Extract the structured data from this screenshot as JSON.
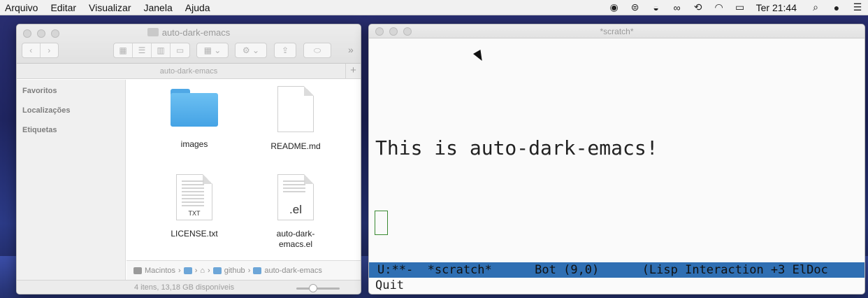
{
  "menubar": {
    "items": [
      "Arquivo",
      "Editar",
      "Visualizar",
      "Janela",
      "Ajuda"
    ],
    "status_icons": [
      "record-icon",
      "network-icon",
      "mask-icon",
      "glasses-icon",
      "time-machine-icon",
      "wifi-icon",
      "battery-icon"
    ],
    "clock": "Ter 21:44"
  },
  "finder": {
    "title": "auto-dark-emacs",
    "path_title": "auto-dark-emacs",
    "sidebar": [
      "Favoritos",
      "Localizações",
      "Etiquetas"
    ],
    "files": [
      {
        "name": "images",
        "kind": "folder"
      },
      {
        "name": "README.md",
        "kind": "doc"
      },
      {
        "name": "LICENSE.txt",
        "kind": "txt",
        "badge": "TXT"
      },
      {
        "name": "auto-dark-\nemacs.el",
        "kind": "el",
        "badge": ".el"
      }
    ],
    "breadcrumb": [
      "Macintos",
      "",
      "",
      "github",
      "auto-dark-emacs"
    ],
    "status": "4 itens, 13,18 GB disponíveis"
  },
  "emacs": {
    "title": "*scratch*",
    "body_text": "This is auto-dark-emacs!",
    "modeline": "U:**-  *scratch*      Bot (9,0)      (Lisp Interaction +3 ElDoc",
    "minibuffer": "Quit",
    "modeline_color": "#2f6fb3"
  }
}
